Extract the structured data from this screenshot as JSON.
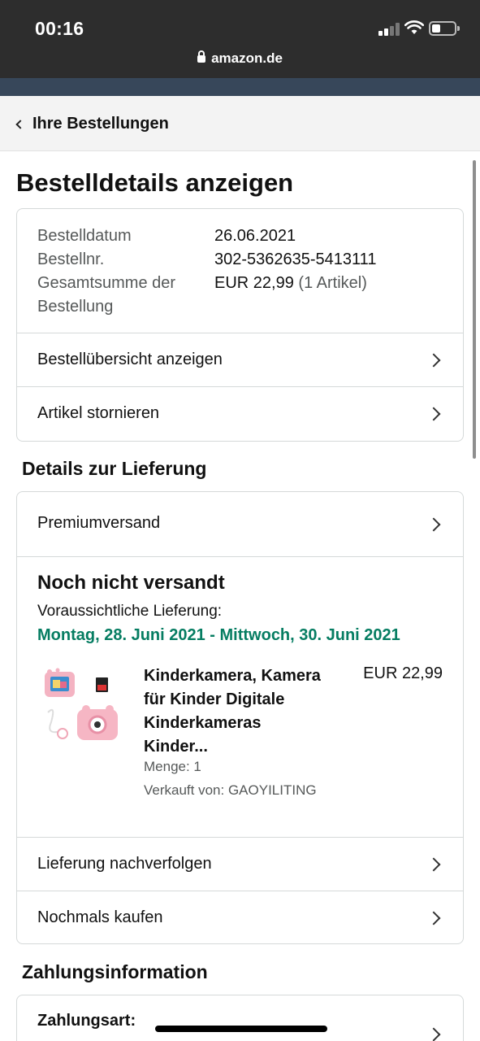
{
  "status_bar": {
    "time": "00:16",
    "url": "amazon.de"
  },
  "nav": {
    "back_label": "Ihre Bestellungen"
  },
  "page_title": "Bestelldetails anzeigen",
  "order_info": {
    "date_label": "Bestelldatum",
    "date_value": "26.06.2021",
    "number_label": "Bestellnr.",
    "number_value": "302-5362635-5413111",
    "total_label_line1": "Gesamtsumme der",
    "total_label_line2": "Bestellung",
    "total_value": "EUR 22,99",
    "total_items": "(1 Artikel)"
  },
  "order_actions": [
    {
      "label": "Bestellübersicht anzeigen"
    },
    {
      "label": "Artikel stornieren"
    }
  ],
  "delivery": {
    "section_title": "Details zur Lieferung",
    "shipping_method": "Premiumversand",
    "status": "Noch nicht versandt",
    "eta_label": "Voraussichtliche Lieferung:",
    "eta_dates": "Montag, 28. Juni 2021 - Mittwoch, 30. Juni 2021",
    "product": {
      "title_line1": "Kinderkamera, Kamera",
      "title_line2": "für Kinder Digitale",
      "title_line3": "Kinderkameras",
      "title_line4": "Kinder...",
      "price": "EUR 22,99",
      "quantity": "Menge: 1",
      "seller": "Verkauft von: GAOYILITING",
      "image_icon": "kids-camera-image"
    },
    "actions": [
      {
        "label": "Lieferung nachverfolgen"
      },
      {
        "label": "Nochmals kaufen"
      }
    ]
  },
  "payment": {
    "section_title": "Zahlungsinformation",
    "method_label": "Zahlungsart:"
  },
  "colors": {
    "eta_green": "#067d62",
    "header_dark": "#2d2d2d",
    "amazon_navy": "#37475a"
  }
}
